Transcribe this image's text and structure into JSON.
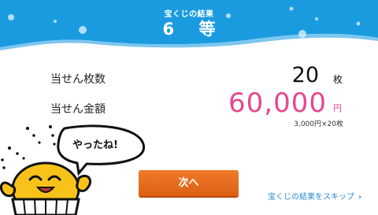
{
  "header": {
    "subtitle": "宝くじの結果",
    "title": "6 等",
    "bg_color": "#1a9be0"
  },
  "result": {
    "count_label": "当せん枚数",
    "count_value": "20",
    "count_unit": "枚",
    "amount_label": "当せん金額",
    "amount_value": "60,000",
    "amount_unit": "円",
    "amount_calc": "3,000円×20枚",
    "amount_color": "#e8468f"
  },
  "mascot": {
    "speech": "やったね!",
    "icon": "mascot-character"
  },
  "actions": {
    "next_label": "次へ",
    "skip_label": "宝くじの結果をスキップ",
    "skip_icon": "chevron-right-icon"
  }
}
